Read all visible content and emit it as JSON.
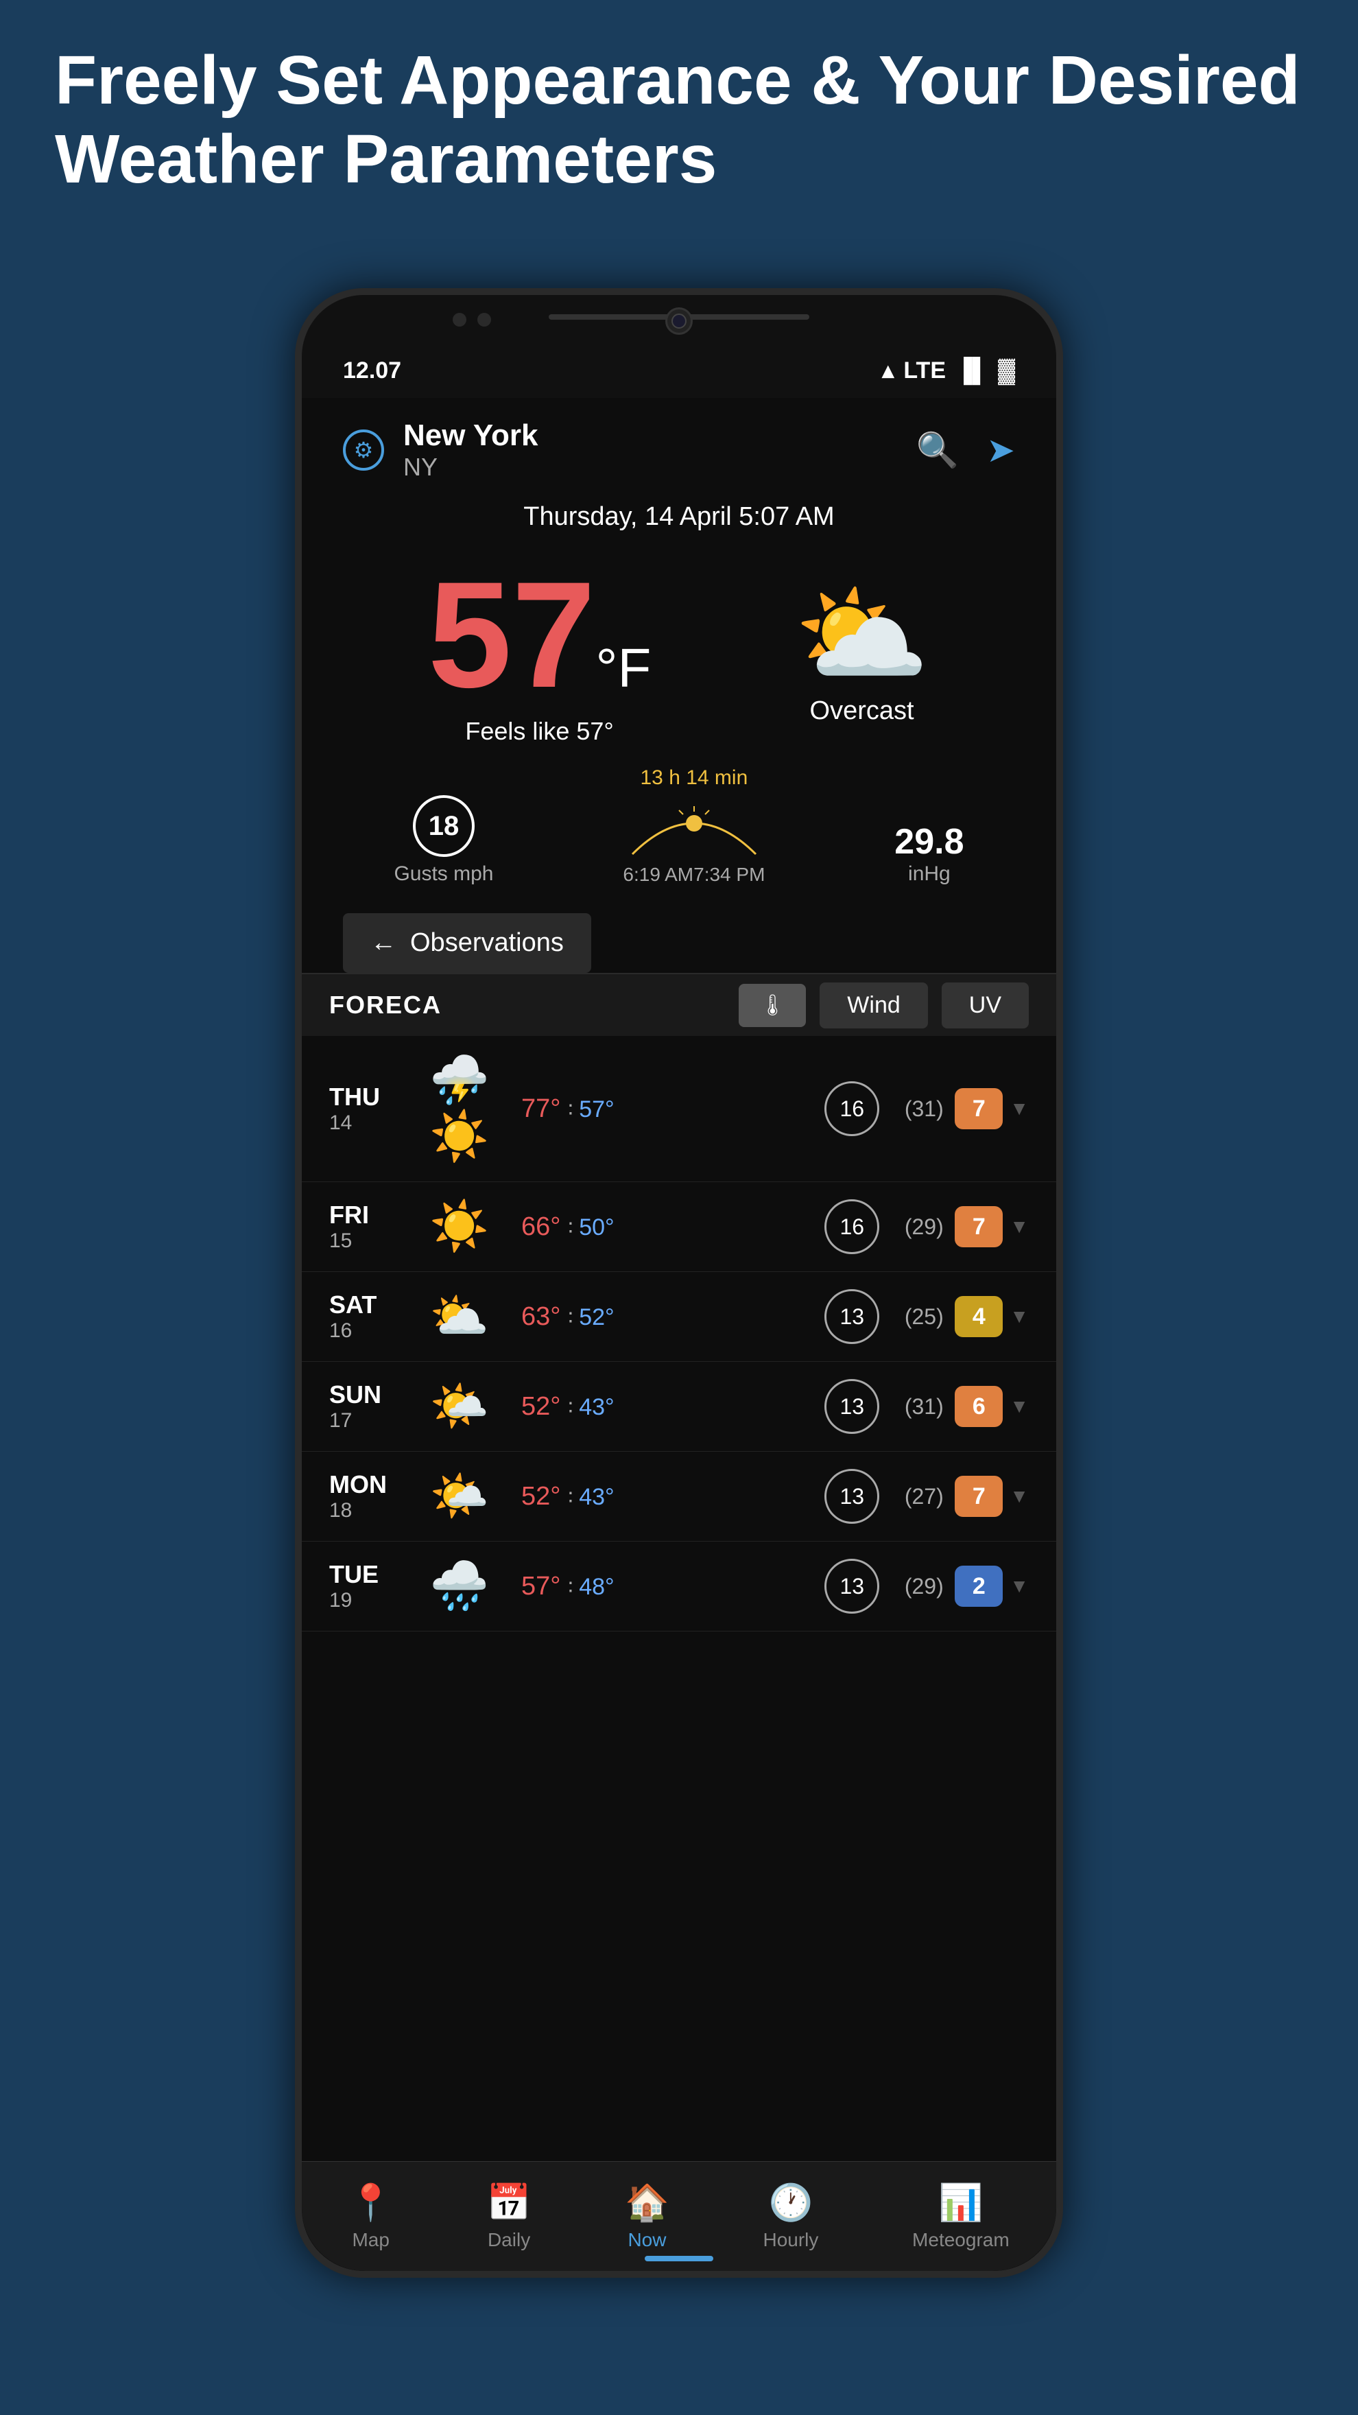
{
  "header": {
    "title": "Freely Set Appearance & Your Desired Weather Parameters"
  },
  "status_bar": {
    "time": "12.07",
    "network": "LTE"
  },
  "app": {
    "city": "New York",
    "state": "NY",
    "date": "Thursday, 14 April 5:07 AM",
    "temperature": "57",
    "unit": "°F",
    "feels_like": "Feels like 57°",
    "condition": "Overcast",
    "gusts": "18",
    "gusts_label": "Gusts mph",
    "sun_duration": "13 h 14 min",
    "sunrise": "6:19 AM",
    "sunset": "7:34 PM",
    "pressure": "29.8",
    "pressure_unit": "inHg",
    "observations_btn": "Observations"
  },
  "forecast_tabs": {
    "thermometer": "🌡",
    "wind": "Wind",
    "uv": "UV"
  },
  "forecast": [
    {
      "day": "THU",
      "num": "14",
      "icon": "⛈️☀️",
      "high": "77°",
      "low": "57°",
      "wind": "16",
      "wind_gust": "(31)",
      "uv": "7",
      "uv_class": "uv-orange"
    },
    {
      "day": "FRI",
      "num": "15",
      "icon": "☀️",
      "high": "66°",
      "low": "50°",
      "wind": "16",
      "wind_gust": "(29)",
      "uv": "7",
      "uv_class": "uv-orange"
    },
    {
      "day": "SAT",
      "num": "16",
      "icon": "⛅",
      "high": "63°",
      "low": "52°",
      "wind": "13",
      "wind_gust": "(25)",
      "uv": "4",
      "uv_class": "uv-yellow"
    },
    {
      "day": "SUN",
      "num": "17",
      "icon": "🌤️",
      "high": "52°",
      "low": "43°",
      "wind": "13",
      "wind_gust": "(31)",
      "uv": "6",
      "uv_class": "uv-orange"
    },
    {
      "day": "MON",
      "num": "18",
      "icon": "🌤️",
      "high": "52°",
      "low": "43°",
      "wind": "13",
      "wind_gust": "(27)",
      "uv": "7",
      "uv_class": "uv-orange"
    },
    {
      "day": "TUE",
      "num": "19",
      "icon": "🌧️",
      "high": "57°",
      "low": "48°",
      "wind": "13",
      "wind_gust": "(29)",
      "uv": "2",
      "uv_class": "uv-blue"
    }
  ],
  "bottom_nav": {
    "map": "Map",
    "daily": "Daily",
    "now": "Now",
    "hourly": "Hourly",
    "meteogram": "Meteogram"
  }
}
